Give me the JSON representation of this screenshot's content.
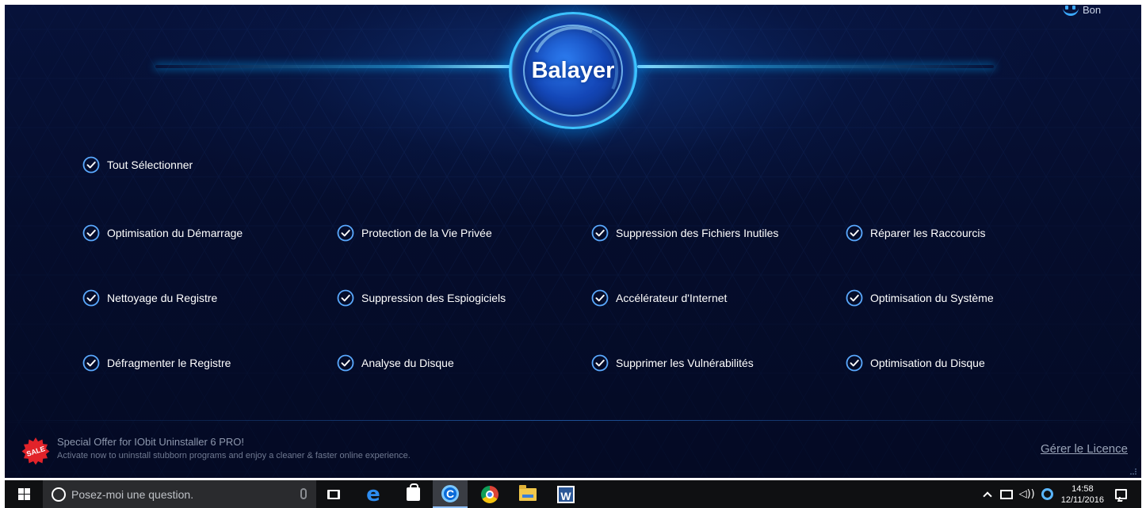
{
  "scan": {
    "label": "Balayer"
  },
  "status": {
    "label": "Bon",
    "icon": "smiley-icon"
  },
  "select_all": {
    "label": "Tout Sélectionner",
    "checked": true
  },
  "options": [
    {
      "label": "Optimisation du Démarrage",
      "checked": true
    },
    {
      "label": "Protection de la Vie Privée",
      "checked": true
    },
    {
      "label": "Suppression des Fichiers Inutiles",
      "checked": true
    },
    {
      "label": "Réparer les Raccourcis",
      "checked": true
    },
    {
      "label": "Nettoyage du Registre",
      "checked": true
    },
    {
      "label": "Suppression des Espiogiciels",
      "checked": true
    },
    {
      "label": "Accélérateur d'Internet",
      "checked": true
    },
    {
      "label": "Optimisation du Système",
      "checked": true
    },
    {
      "label": "Défragmenter le Registre",
      "checked": true
    },
    {
      "label": "Analyse du Disque",
      "checked": true
    },
    {
      "label": "Supprimer les Vulnérabilités",
      "checked": true
    },
    {
      "label": "Optimisation du Disque",
      "checked": true
    }
  ],
  "offer": {
    "badge": "SALE",
    "title": "Special Offer for IObit Uninstaller 6 PRO!",
    "subtitle": "Activate now to uninstall stubborn programs and enjoy a cleaner & faster online experience."
  },
  "license_link": "Gérer le Licence",
  "taskbar": {
    "search_placeholder": "Posez-moi une question.",
    "pinned": [
      "task-view-icon",
      "edge-icon",
      "store-icon",
      "advanced-systemcare-icon",
      "chrome-icon",
      "file-explorer-icon",
      "word-icon"
    ],
    "active_app": "advanced-systemcare-icon",
    "tray": {
      "time": "14:58",
      "date": "12/11/2016"
    }
  },
  "colors": {
    "background": "#050d2c",
    "accent": "#3cc2ff",
    "check": "#5aa9ff",
    "taskbar": "#0f1012"
  }
}
